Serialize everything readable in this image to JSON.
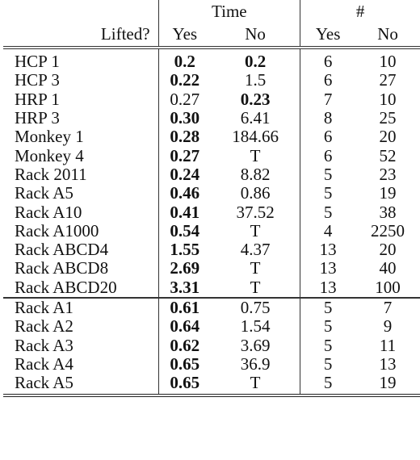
{
  "table": {
    "header": {
      "row_label": "Lifted?",
      "groups": [
        {
          "label": "Time",
          "sub": [
            "Yes",
            "No"
          ]
        },
        {
          "label": "#",
          "sub": [
            "Yes",
            "No"
          ]
        }
      ]
    },
    "sections": [
      {
        "rows": [
          {
            "name": "HCP 1",
            "time_yes": "0.2",
            "time_no": "0.2",
            "count_yes": "6",
            "count_no": "10",
            "bold": [
              "time_yes",
              "time_no"
            ]
          },
          {
            "name": "HCP 3",
            "time_yes": "0.22",
            "time_no": "1.5",
            "count_yes": "6",
            "count_no": "27",
            "bold": [
              "time_yes"
            ]
          },
          {
            "name": "HRP 1",
            "time_yes": "0.27",
            "time_no": "0.23",
            "count_yes": "7",
            "count_no": "10",
            "bold": [
              "time_no"
            ]
          },
          {
            "name": "HRP 3",
            "time_yes": "0.30",
            "time_no": "6.41",
            "count_yes": "8",
            "count_no": "25",
            "bold": [
              "time_yes"
            ]
          },
          {
            "name": "Monkey 1",
            "time_yes": "0.28",
            "time_no": "184.66",
            "count_yes": "6",
            "count_no": "20",
            "bold": [
              "time_yes"
            ]
          },
          {
            "name": "Monkey 4",
            "time_yes": "0.27",
            "time_no": "T",
            "count_yes": "6",
            "count_no": "52",
            "bold": [
              "time_yes"
            ]
          },
          {
            "name": "Rack 2011",
            "time_yes": "0.24",
            "time_no": "8.82",
            "count_yes": "5",
            "count_no": "23",
            "bold": [
              "time_yes"
            ]
          },
          {
            "name": "Rack A5",
            "time_yes": "0.46",
            "time_no": "0.86",
            "count_yes": "5",
            "count_no": "19",
            "bold": [
              "time_yes"
            ]
          },
          {
            "name": "Rack A10",
            "time_yes": "0.41",
            "time_no": "37.52",
            "count_yes": "5",
            "count_no": "38",
            "bold": [
              "time_yes"
            ]
          },
          {
            "name": "Rack A1000",
            "time_yes": "0.54",
            "time_no": "T",
            "count_yes": "4",
            "count_no": "2250",
            "bold": [
              "time_yes"
            ]
          },
          {
            "name": "Rack ABCD4",
            "time_yes": "1.55",
            "time_no": "4.37",
            "count_yes": "13",
            "count_no": "20",
            "bold": [
              "time_yes"
            ]
          },
          {
            "name": "Rack ABCD8",
            "time_yes": "2.69",
            "time_no": "T",
            "count_yes": "13",
            "count_no": "40",
            "bold": [
              "time_yes"
            ]
          },
          {
            "name": "Rack ABCD20",
            "time_yes": "3.31",
            "time_no": "T",
            "count_yes": "13",
            "count_no": "100",
            "bold": [
              "time_yes"
            ]
          }
        ]
      },
      {
        "rows": [
          {
            "name": "Rack A1",
            "time_yes": "0.61",
            "time_no": "0.75",
            "count_yes": "5",
            "count_no": "7",
            "bold": [
              "time_yes"
            ]
          },
          {
            "name": "Rack A2",
            "time_yes": "0.64",
            "time_no": "1.54",
            "count_yes": "5",
            "count_no": "9",
            "bold": [
              "time_yes"
            ]
          },
          {
            "name": "Rack A3",
            "time_yes": "0.62",
            "time_no": "3.69",
            "count_yes": "5",
            "count_no": "11",
            "bold": [
              "time_yes"
            ]
          },
          {
            "name": "Rack A4",
            "time_yes": "0.65",
            "time_no": "36.9",
            "count_yes": "5",
            "count_no": "13",
            "bold": [
              "time_yes"
            ]
          },
          {
            "name": "Rack A5",
            "time_yes": "0.65",
            "time_no": "T",
            "count_yes": "5",
            "count_no": "19",
            "bold": [
              "time_yes"
            ]
          }
        ]
      }
    ]
  }
}
